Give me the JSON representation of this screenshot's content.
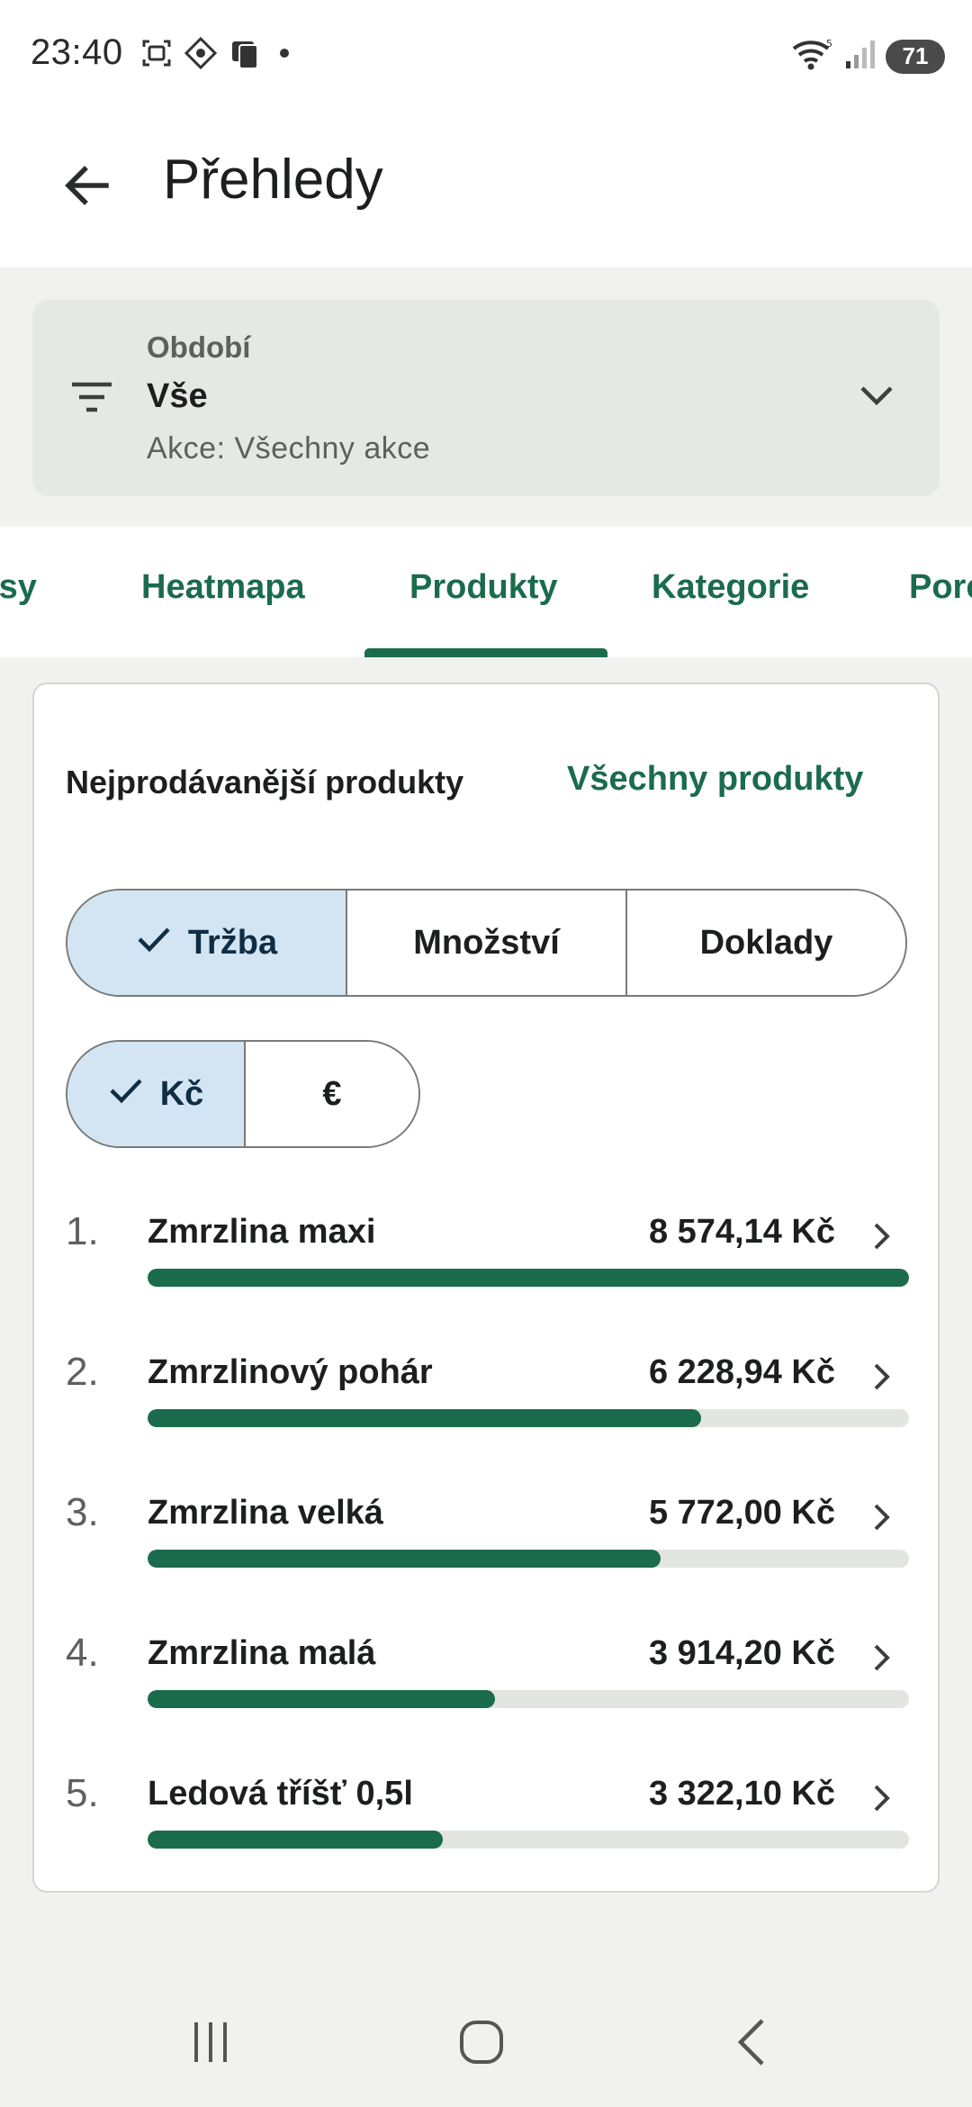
{
  "status_bar": {
    "time": "23:40",
    "battery": "71",
    "icons": [
      "screenshot-icon",
      "location-icon",
      "device-icon",
      "dot-icon",
      "wifi-icon",
      "signal-icon",
      "battery-icon"
    ]
  },
  "app_bar": {
    "title": "Přehledy",
    "back_icon": "arrow-left-icon"
  },
  "filter": {
    "label": "Období",
    "value": "Vše",
    "subtitle": "Akce: Všechny akce",
    "icon": "filter-icon",
    "expand_icon": "chevron-down-icon"
  },
  "tabs": [
    {
      "label": "Kasy"
    },
    {
      "label": "Heatmapa"
    },
    {
      "label": "Produkty",
      "selected": true
    },
    {
      "label": "Kategorie"
    },
    {
      "label": "Pore"
    }
  ],
  "card": {
    "title": "Nejprodávanější produkty",
    "link": "Všechny produkty",
    "metric_toggle": [
      {
        "label": "Tržba",
        "selected": true
      },
      {
        "label": "Množství",
        "selected": false
      },
      {
        "label": "Doklady",
        "selected": false
      }
    ],
    "currency_toggle": [
      {
        "label": "Kč",
        "selected": true
      },
      {
        "label": "€",
        "selected": false
      }
    ],
    "products": [
      {
        "rank": "1.",
        "name": "Zmrzlina maxi",
        "value": "8 574,14 Kč",
        "share": 1.0
      },
      {
        "rank": "2.",
        "name": "Zmrzlinový pohár",
        "value": "6 228,94 Kč",
        "share": 0.7265
      },
      {
        "rank": "3.",
        "name": "Zmrzlina velká",
        "value": "5 772,00 Kč",
        "share": 0.6732
      },
      {
        "rank": "4.",
        "name": "Zmrzlina malá",
        "value": "3 914,20 Kč",
        "share": 0.4565
      },
      {
        "rank": "5.",
        "name": "Ledová tříšť 0,5l",
        "value": "3 322,10 Kč",
        "share": 0.3875
      }
    ]
  },
  "colors": {
    "accent": "#1b6b4d",
    "selected_segment": "#d3e5f3",
    "surface_grey": "#f1f2f0",
    "bar_track": "#e3e5e1"
  }
}
